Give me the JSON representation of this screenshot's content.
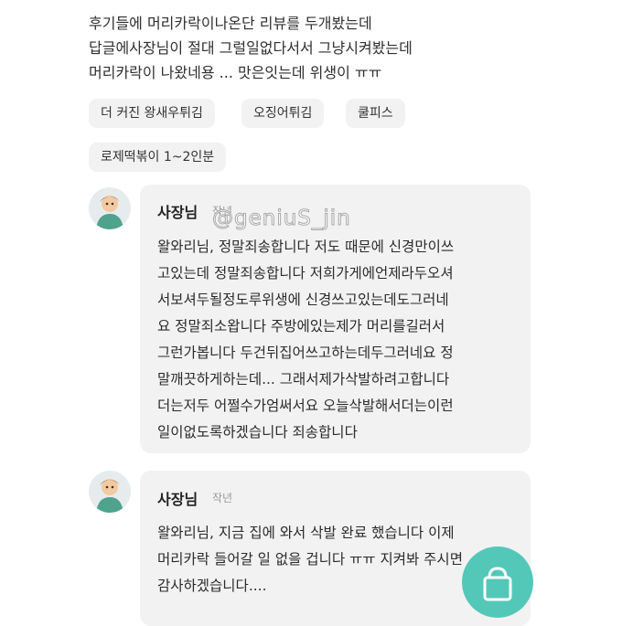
{
  "review": {
    "lines": [
      "후기들에 머리카락이나온단 리뷰를 두개봤는데",
      "답글에사장님이 절대 그럴일없다서서 그냥시켜봤는데",
      "머리카락이 나왔네용 ... 맛은잇는데 위생이 ㅠㅠ"
    ]
  },
  "tags": [
    "더 커진 왕새우튀김",
    "오징어튀김",
    "쿨피스",
    "로제떡볶이 1~2인분"
  ],
  "replies": [
    {
      "author": "사장님",
      "time": "작년",
      "lines": [
        "왈와리님,  정말죄송합니다 저도 때문에 신경만이쓰",
        "고있는데 정말죄송합니다 저희가게에언제라두오셔",
        "서보셔두될정도루위생에 신경쓰고있는데도그러네",
        "요  정말죄소왑니다 주방에있는제가 머리를길러서",
        "그런가봅니다 두건뒤집어쓰고하는데두그러네요  정",
        "말깨끗하게하는데... 그래서제가삭발하려고합니다",
        "더는저두 어쩔수가엄써서요 오늘삭발해서더는이런",
        "일이없도록하겠습니다 죄송합니다"
      ]
    },
    {
      "author": "사장님",
      "time": "작년",
      "lines": [
        "왈와리님, 지금 집에 와서 삭발 완료 했습니다 이제",
        "머리카락 들어갈 일 없을 겁니다 ㅠㅠ 지켜봐 주시면",
        "감사하겠습니다...."
      ]
    }
  ],
  "watermark": "@geniuS_jin",
  "colors": {
    "bubble": "#f3f2f2",
    "tag": "#f2f2f2",
    "fab": "#53c8b9"
  },
  "icons": {
    "fab": "shopping-bag-icon",
    "avatar": "owner-avatar-icon"
  }
}
